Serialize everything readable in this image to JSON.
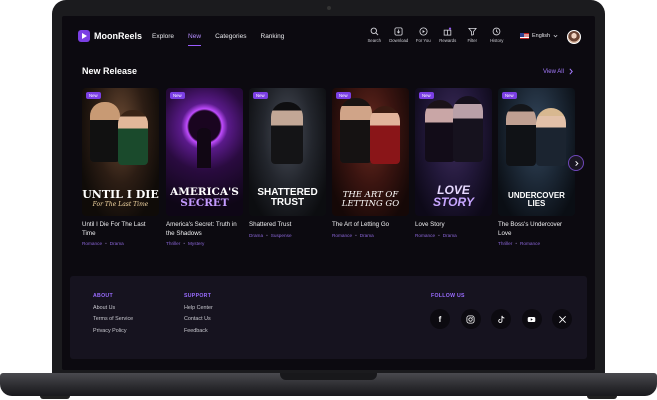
{
  "brand": {
    "name": "MoonReels",
    "accent": "#7b3fe4"
  },
  "nav": {
    "menu": [
      {
        "label": "Explore",
        "active": false
      },
      {
        "label": "New",
        "active": true
      },
      {
        "label": "Categories",
        "active": false
      },
      {
        "label": "Ranking",
        "active": false
      }
    ],
    "tools": [
      {
        "label": "Search",
        "icon": "search-icon"
      },
      {
        "label": "Download",
        "icon": "download-icon"
      },
      {
        "label": "For You",
        "icon": "play-circle-icon"
      },
      {
        "label": "Rewards",
        "icon": "gift-icon"
      },
      {
        "label": "Filter",
        "icon": "filter-icon"
      },
      {
        "label": "History",
        "icon": "history-icon"
      }
    ],
    "language": "English"
  },
  "section": {
    "title": "New Release",
    "view_all": "View All"
  },
  "cards": [
    {
      "badge": "New",
      "poster_line1": "UNTIL I DIE",
      "poster_line2": "For The Last Time",
      "title": "Until I Die For The Last Time",
      "tags": [
        "Romance",
        "Drama"
      ]
    },
    {
      "badge": "New",
      "poster_line1": "AMERICA'S",
      "poster_line2": "SECRET",
      "title": "America's Secret: Truth in the Shadows",
      "tags": [
        "Thriller",
        "Mystery"
      ]
    },
    {
      "badge": "New",
      "poster_line1": "SHATTERED",
      "poster_line2": "TRUST",
      "title": "Shattered Trust",
      "tags": [
        "Drama",
        "Suspense"
      ]
    },
    {
      "badge": "New",
      "poster_line1": "THE ART OF",
      "poster_line2": "LETTING GO",
      "title": "The Art of Letting Go",
      "tags": [
        "Romance",
        "Drama"
      ]
    },
    {
      "badge": "New",
      "poster_line1": "LOVE",
      "poster_line2": "STORY",
      "title": "Love Story",
      "tags": [
        "Romance",
        "Drama"
      ]
    },
    {
      "badge": "New",
      "poster_line1": "UNDERCOVER",
      "poster_line2": "LIES",
      "title": "The Boss's Undercover Love",
      "tags": [
        "Thriller",
        "Romance"
      ]
    }
  ],
  "footer": {
    "about": {
      "heading": "ABOUT",
      "links": [
        "About Us",
        "Terms of Service",
        "Privacy Policy"
      ]
    },
    "support": {
      "heading": "SUPPORT",
      "links": [
        "Help Center",
        "Contact Us",
        "Feedback"
      ]
    },
    "follow": {
      "heading": "FOLLOW US",
      "icons": [
        "facebook-icon",
        "instagram-icon",
        "tiktok-icon",
        "youtube-icon",
        "x-icon"
      ]
    }
  }
}
